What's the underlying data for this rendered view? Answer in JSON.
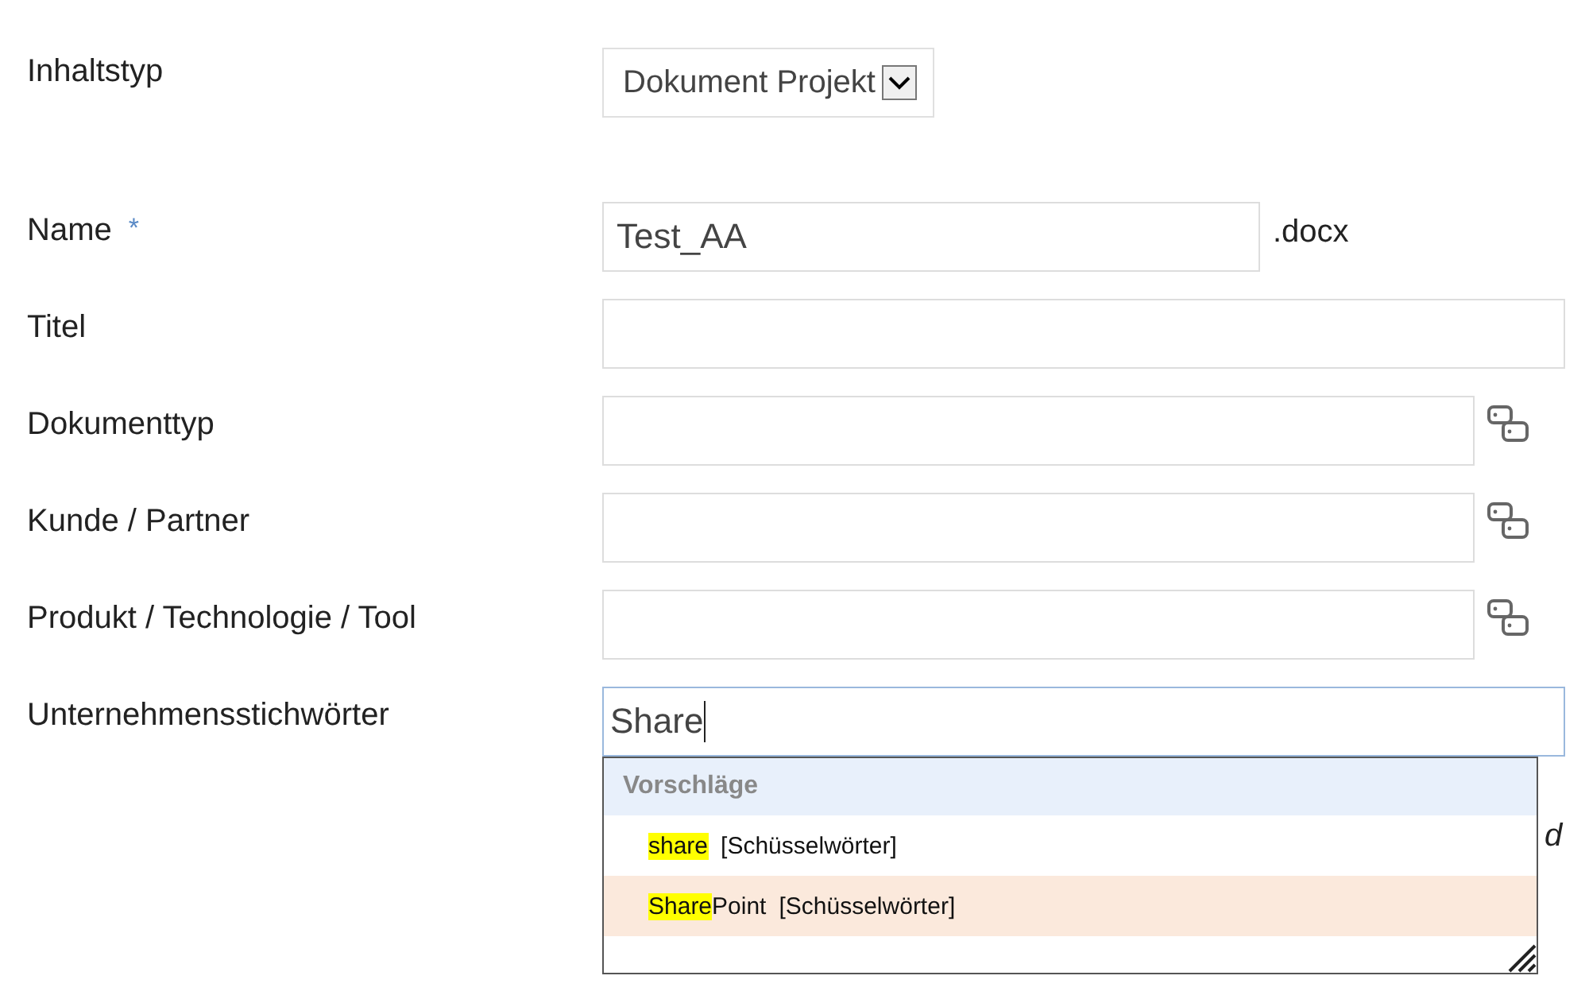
{
  "fields": [
    {
      "label": "Inhaltstyp",
      "kind": "select",
      "value": "Dokument Projekt"
    },
    {
      "label": "Name",
      "required_mark": "*",
      "kind": "text",
      "value": "Test_AA",
      "suffix": ".docx"
    },
    {
      "label": "Titel",
      "kind": "text"
    },
    {
      "label": "Dokumenttyp",
      "kind": "lookup"
    },
    {
      "label": "Kunde / Partner",
      "kind": "lookup"
    },
    {
      "label": "Produkt / Technologie / Tool",
      "kind": "lookup"
    },
    {
      "label": "Unternehmensstichwörter",
      "kind": "text",
      "value": "Share",
      "focused": true
    }
  ],
  "suggestions": {
    "header": "Vorschläge",
    "items": [
      {
        "match": "share",
        "category": "[Schüsselwörter]",
        "selected": false
      },
      {
        "match": "Share",
        "rest": "Point",
        "category": "[Schüsselwörter]",
        "selected": true
      }
    ]
  },
  "covered_text_fragment": "d"
}
